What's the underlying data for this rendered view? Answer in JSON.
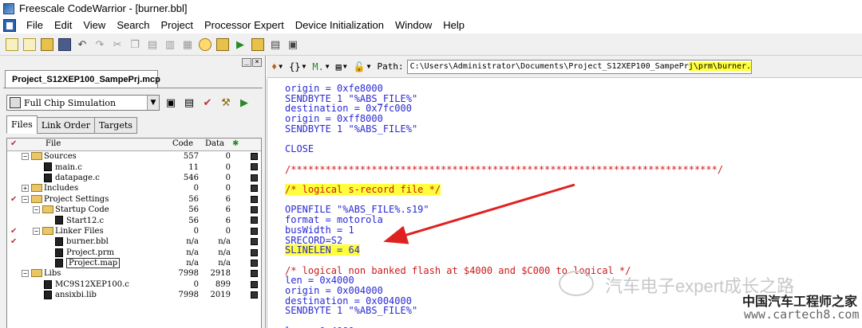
{
  "window": {
    "title": "Freescale CodeWarrior - [burner.bbl]"
  },
  "menu": [
    "File",
    "Edit",
    "View",
    "Search",
    "Project",
    "Processor Expert",
    "Device Initialization",
    "Window",
    "Help"
  ],
  "project": {
    "tab_label": "Project_S12XEP100_SampePrj.mcp",
    "target": "Full Chip Simulation",
    "subtabs": [
      "Files",
      "Link Order",
      "Targets"
    ],
    "columns": {
      "file": "File",
      "code": "Code",
      "data": "Data"
    },
    "files": [
      {
        "check": "",
        "exp": "−",
        "type": "folder",
        "indent": 0,
        "name": "Sources",
        "code": "557",
        "data": "0"
      },
      {
        "check": "",
        "exp": "",
        "type": "file",
        "indent": 1,
        "name": "main.c",
        "code": "11",
        "data": "0"
      },
      {
        "check": "",
        "exp": "",
        "type": "file",
        "indent": 1,
        "name": "datapage.c",
        "code": "546",
        "data": "0"
      },
      {
        "check": "",
        "exp": "+",
        "type": "folder",
        "indent": 0,
        "name": "Includes",
        "code": "0",
        "data": "0"
      },
      {
        "check": "✔",
        "exp": "−",
        "type": "folder",
        "indent": 0,
        "name": "Project Settings",
        "code": "56",
        "data": "6"
      },
      {
        "check": "",
        "exp": "−",
        "type": "folder",
        "indent": 1,
        "name": "Startup Code",
        "code": "56",
        "data": "6"
      },
      {
        "check": "",
        "exp": "",
        "type": "file",
        "indent": 2,
        "name": "Start12.c",
        "code": "56",
        "data": "6"
      },
      {
        "check": "✔",
        "exp": "−",
        "type": "folder",
        "indent": 1,
        "name": "Linker Files",
        "code": "0",
        "data": "0"
      },
      {
        "check": "✔",
        "exp": "",
        "type": "file",
        "indent": 2,
        "name": "burner.bbl",
        "code": "n/a",
        "data": "n/a"
      },
      {
        "check": "",
        "exp": "",
        "type": "file",
        "indent": 2,
        "name": "Project.prm",
        "code": "n/a",
        "data": "n/a"
      },
      {
        "check": "",
        "exp": "",
        "type": "file",
        "indent": 2,
        "name": "Project.map",
        "code": "n/a",
        "data": "n/a",
        "boxed": true
      },
      {
        "check": "",
        "exp": "−",
        "type": "folder",
        "indent": 0,
        "name": "Libs",
        "code": "7998",
        "data": "2918"
      },
      {
        "check": "",
        "exp": "",
        "type": "file",
        "indent": 1,
        "name": "MC9S12XEP100.c",
        "code": "0",
        "data": "899"
      },
      {
        "check": "",
        "exp": "",
        "type": "file",
        "indent": 1,
        "name": "ansixbi.lib",
        "code": "7998",
        "data": "2019"
      }
    ]
  },
  "editor": {
    "path_label": "Path:",
    "path_prefix": "C:\\Users\\Administrator\\Documents\\Project_S12XEP100_SampePr",
    "path_highlight": "j\\prm\\burner.bbl",
    "lines": [
      {
        "text": "origin = 0xfe8000",
        "kind": "code"
      },
      {
        "text": "SENDBYTE 1 \"%ABS_FILE%\"",
        "kind": "code"
      },
      {
        "text": "destination = 0x7fc000",
        "kind": "code"
      },
      {
        "text": "origin = 0xff8000",
        "kind": "code"
      },
      {
        "text": "SENDBYTE 1 \"%ABS_FILE%\"",
        "kind": "code"
      },
      {
        "text": "",
        "kind": "code"
      },
      {
        "text": "CLOSE",
        "kind": "code"
      },
      {
        "text": "",
        "kind": "code"
      },
      {
        "text": "/**************************************************************************/",
        "kind": "comment"
      },
      {
        "text": "",
        "kind": "code"
      },
      {
        "text": "/* logical s-record file */",
        "kind": "comment",
        "highlight": true
      },
      {
        "text": "",
        "kind": "code"
      },
      {
        "text": "OPENFILE \"%ABS_FILE%.s19\"",
        "kind": "code"
      },
      {
        "text": "format = motorola",
        "kind": "code"
      },
      {
        "text": "busWidth = 1",
        "kind": "code"
      },
      {
        "text": "SRECORD=S2",
        "kind": "code"
      },
      {
        "text": "SLINELEN = 64",
        "kind": "code",
        "highlight": true
      },
      {
        "text": "",
        "kind": "code"
      },
      {
        "text": "/* logical non banked flash at $4000 and $C000 to logical */",
        "kind": "comment"
      },
      {
        "text": "len = 0x4000",
        "kind": "code"
      },
      {
        "text": "origin = 0x004000",
        "kind": "code"
      },
      {
        "text": "destination = 0x004000",
        "kind": "code"
      },
      {
        "text": "SENDBYTE 1 \"%ABS_FILE%\"",
        "kind": "code"
      },
      {
        "text": "",
        "kind": "code"
      },
      {
        "text": "len = 0x4000",
        "kind": "code"
      }
    ]
  },
  "watermark": {
    "text": "汽车电子expert成长之路",
    "cn": "中国汽车工程师之家",
    "url": "www.cartech8.com"
  },
  "colors": {
    "code": "#2a2ad4",
    "comment": "#cc1a1a",
    "highlight": "#ffff3a",
    "arrow": "#e02020"
  }
}
